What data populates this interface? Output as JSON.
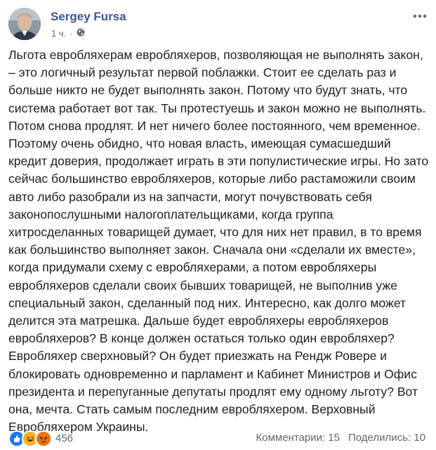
{
  "post": {
    "author": "Sergey Fursa",
    "time": "1 ч.",
    "dot": "·",
    "body": "Льгота евробляхерам евробляхеров, позволяющая не выполнять закон, – это логичный результат первой поблажки. Стоит ее сделать раз и больше никто не будет выполнять закон. Потому что будут знать, что система работает вот так. Ты протестуешь и закон можно не выполнять. Потом снова продлят. И нет ничего более постоянного, чем временное. Поэтому очень обидно, что новая власть, имеющая сумасшедший кредит доверия, продолжает играть в эти популистические игры. Но зато сейчас большинство евробляхеров, которые либо растаможили своим авто либо разобрали из на запчасти, могут почувствовать себя законопослушными налогоплательщиками, когда группа хитросделанных товарищей думает, что для них нет правил, в то время как большинство выполняет закон. Сначала они «сделали их вместе», когда придумали схему с евробляхерами, а потом евробляхеры евробляхеров сделали своих бывших товарищей, не выполнив уже специальный закон, сделанный под них. Интересно, как долго может делится эта матрешка. Дальше будет евробляхеры евробляхеров евробляхеров? В конце должен остаться только один евробляхер? Евробляхер сверхновый? Он будет приезжать на Рендж Ровере и блокировать одновременно и парламент и Кабинет Министров и Офис президента и перепуганные депутаты продлят ему одному льготу? Вот она, мечта. Стать самым последним евробляхером. Верховный Евробляхером Украины."
  },
  "footer": {
    "reactions_count": "456",
    "comments": "Комментарии: 15",
    "shares": "Поделились: 10",
    "reaction_icons": [
      "like-icon",
      "haha-icon",
      "angry-icon"
    ]
  },
  "colors": {
    "author": "#385898",
    "like": "#1877f2",
    "haha": "#f7b125",
    "angry": "#e9710f"
  }
}
